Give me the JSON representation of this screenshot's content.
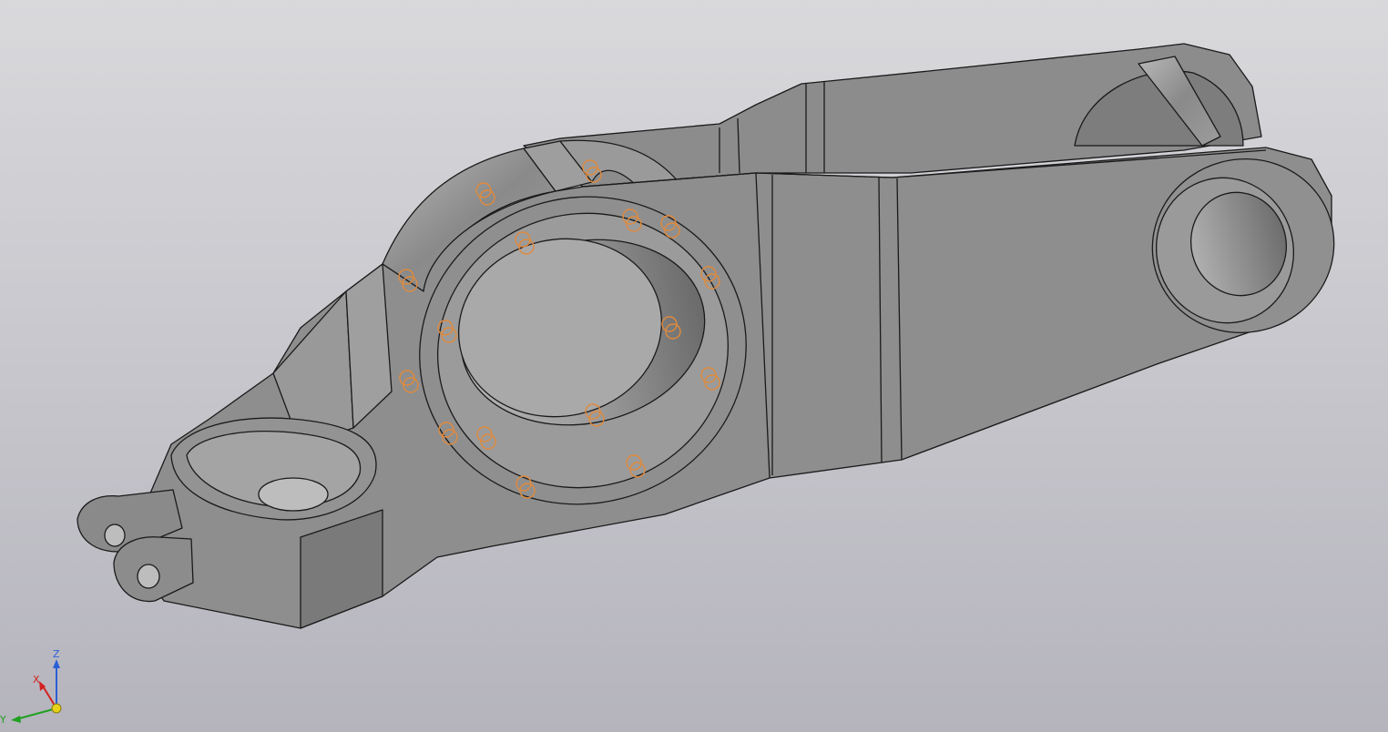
{
  "viewport": {
    "background_top": "#d9d9dc",
    "background_bottom": "#b5b4bd"
  },
  "model": {
    "body_color": "#8e8e8e",
    "face_light": "#a3a3a3",
    "face_dark": "#6f6f6f",
    "edge_color": "#1a1a1a",
    "highlight_color": "#e08a3c",
    "highlighted_features": "bolt-holes"
  },
  "triad": {
    "x_label": "X",
    "y_label": "Y",
    "z_label": "Z",
    "x_color": "#d42020",
    "y_color": "#20a020",
    "z_color": "#2a5fd6",
    "origin_color": "#e6d21a"
  }
}
